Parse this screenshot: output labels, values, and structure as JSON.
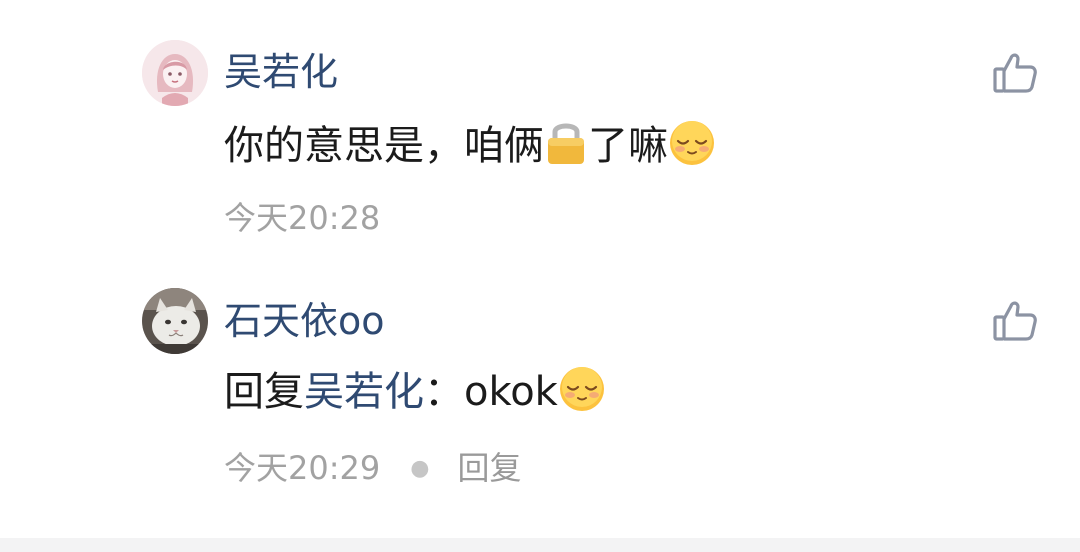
{
  "comments": [
    {
      "username": "吴若化",
      "content_before": "你的意思是，咱俩",
      "content_after": "了嘛",
      "inline_icons": [
        "lock-icon",
        "smiling-closed-eyes-emoji"
      ],
      "time": "今天20:28"
    },
    {
      "username": "石天依oo",
      "reply_prefix": "回复",
      "reply_to": "吴若化",
      "separator": "：",
      "content": "okok",
      "inline_icons": [
        "smiling-closed-eyes-emoji"
      ],
      "time": "今天20:29",
      "reply_label": "回复"
    }
  ],
  "colors": {
    "username": "#2f4a72",
    "text": "#1b1b1b",
    "meta": "#a2a2a2",
    "icon_outline": "#8c93a3"
  },
  "icons": [
    "avatar",
    "thumbs-up-icon",
    "lock-icon",
    "smiling-closed-eyes-emoji"
  ]
}
